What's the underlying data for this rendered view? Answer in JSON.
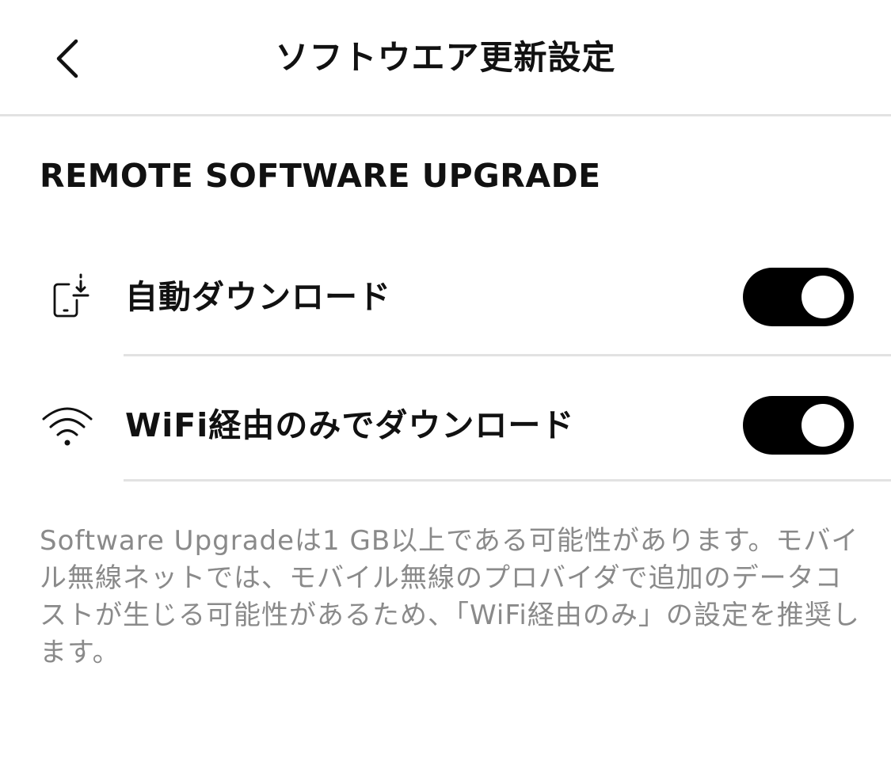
{
  "header": {
    "title": "ソフトウエア更新設定",
    "back_icon": "chevron-left-icon"
  },
  "section": {
    "heading": "REMOTE SOFTWARE UPGRADE"
  },
  "settings": [
    {
      "label": "自動ダウンロード",
      "icon": "phone-download-icon",
      "enabled": true
    },
    {
      "label": "WiFi経由のみでダウンロード",
      "icon": "wifi-icon",
      "enabled": true
    }
  ],
  "note": "Software Upgradeは1 GB以上である可能性があります。モバイル無線ネットでは、モバイル無線のプロバイダで追加のデータコストが生じる可能性があるため、「WiFi経由のみ」の設定を推奨します。",
  "colors": {
    "toggle_on": "#000000",
    "divider": "#e2e2e2",
    "note_text": "#8a8a8a"
  }
}
